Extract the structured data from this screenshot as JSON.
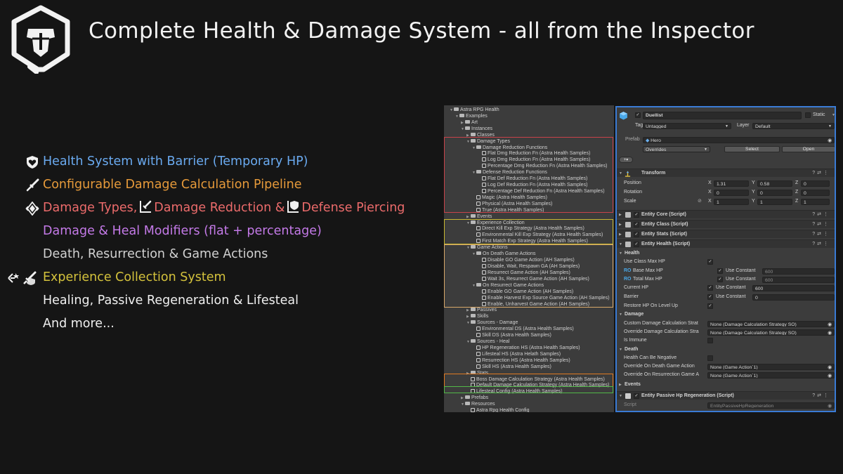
{
  "title": "Complete Health & Damage System - all from the Inspector",
  "colors": {
    "blue": "#6aaaf0",
    "orange": "#e69a3a",
    "red": "#ec6b6b",
    "purple": "#c47ae8",
    "gray": "#d2d2d2",
    "yellow": "#d4c23c",
    "white": "#f0f0f0"
  },
  "features": [
    {
      "text": "Health System with Barrier (Temporary HP)",
      "color": "#6aaaf0",
      "icon": "heart-shield-icon"
    },
    {
      "text": "Configurable Damage Calculation Pipeline",
      "color": "#e69a3a",
      "icon": "sword-icon"
    },
    {
      "part1": "Damage Types,",
      "part2": "Damage Reduction &",
      "part3": "Defense Piercing",
      "color": "#ec6b6b",
      "icon": "damage-types-icon"
    },
    {
      "text": "Damage & Heal Modifiers (flat + percentage)",
      "color": "#c47ae8"
    },
    {
      "text": "Death, Resurrection & Game Actions",
      "color": "#d2d2d2"
    },
    {
      "text": "Experience Collection System",
      "color": "#d4c23c",
      "icon": "experience-icon"
    },
    {
      "text": "Healing, Passive Regeneration & Lifesteal",
      "color": "#f0f0f0"
    },
    {
      "text": "And more...",
      "color": "#f0f0f0"
    }
  ],
  "hierarchy": [
    {
      "t": "Astra RPG Health",
      "d": 0,
      "f": 1,
      "e": 1
    },
    {
      "t": "Examples",
      "d": 1,
      "f": 1,
      "e": 1
    },
    {
      "t": "Art",
      "d": 2,
      "f": 1,
      "e": 0
    },
    {
      "t": "Instances",
      "d": 2,
      "f": 1,
      "e": 1
    },
    {
      "t": "Classes",
      "d": 3,
      "f": 1,
      "e": 0
    },
    {
      "t": "Damage Types",
      "d": 3,
      "f": 1,
      "e": 1
    },
    {
      "t": "Damage Reduction Functions",
      "d": 4,
      "f": 1,
      "e": 1
    },
    {
      "t": "Flat Dmg Reduction Fn (Astra Health Samples)",
      "d": 5,
      "f": 0
    },
    {
      "t": "Log Dmg Reduction Fn (Astra Health Samples)",
      "d": 5,
      "f": 0
    },
    {
      "t": "Percentage Dmg Reduction  Fn (Astra Health Samples)",
      "d": 5,
      "f": 0
    },
    {
      "t": "Defense Reduction Functions",
      "d": 4,
      "f": 1,
      "e": 1
    },
    {
      "t": "Flat Def Reduction Fn (Astra Health Samples)",
      "d": 5,
      "f": 0
    },
    {
      "t": "Log Def Reduction Fn (Astra Health Samples)",
      "d": 5,
      "f": 0
    },
    {
      "t": "Percentage Def Reduction Fn (Astra Health Samples)",
      "d": 5,
      "f": 0
    },
    {
      "t": "Magic (Astra Health Samples)",
      "d": 4,
      "f": 0
    },
    {
      "t": "Physical (Astra Health Samples)",
      "d": 4,
      "f": 0
    },
    {
      "t": "True (Astra Health Samples)",
      "d": 4,
      "f": 0
    },
    {
      "t": "Events",
      "d": 3,
      "f": 1,
      "e": 0
    },
    {
      "t": "Experience Collection",
      "d": 3,
      "f": 1,
      "e": 1
    },
    {
      "t": "Direct Kill Exp Strategy (Astra Health Samples)",
      "d": 4,
      "f": 0
    },
    {
      "t": "Environmental Kill Exp Strategy (Astra Health Samples)",
      "d": 4,
      "f": 0
    },
    {
      "t": "First Match Exp Strategy (Astra Health Samples)",
      "d": 4,
      "f": 0
    },
    {
      "t": "Game Actions",
      "d": 3,
      "f": 1,
      "e": 1
    },
    {
      "t": "On Death Game Actions",
      "d": 4,
      "f": 1,
      "e": 1
    },
    {
      "t": "Disable GO Game Action (AH Samples)",
      "d": 5,
      "f": 0
    },
    {
      "t": "Disable, Wait, Respawn GA (AH Samples)",
      "d": 5,
      "f": 0
    },
    {
      "t": "Resurrect Game Action (AH Samples)",
      "d": 5,
      "f": 0
    },
    {
      "t": "Wait 3s, Resurrect Game Action (AH Samples)",
      "d": 5,
      "f": 0
    },
    {
      "t": "On Resurrect Game Actions",
      "d": 4,
      "f": 1,
      "e": 1
    },
    {
      "t": "Enable GO Game Action (AH Samples)",
      "d": 5,
      "f": 0
    },
    {
      "t": "Enable Harvest Exp Source Game Action (AH Samples)",
      "d": 5,
      "f": 0
    },
    {
      "t": "Enable, Unharvest Game Action (AH Samples)",
      "d": 5,
      "f": 0
    },
    {
      "t": "Passives",
      "d": 3,
      "f": 1,
      "e": 0
    },
    {
      "t": "Skills",
      "d": 3,
      "f": 1,
      "e": 0
    },
    {
      "t": "Sources - Damage",
      "d": 3,
      "f": 1,
      "e": 1
    },
    {
      "t": "Environmental DS (Astra Health Samples)",
      "d": 4,
      "f": 0
    },
    {
      "t": "Skill DS (Astra Health Samples)",
      "d": 4,
      "f": 0
    },
    {
      "t": "Sources - Heal",
      "d": 3,
      "f": 1,
      "e": 1
    },
    {
      "t": "HP Regeneration HS (Astra Health Samples)",
      "d": 4,
      "f": 0
    },
    {
      "t": "Lifesteal HS (Astra Helath Samples)",
      "d": 4,
      "f": 0
    },
    {
      "t": "Resurrection HS (Astra Health Samples)",
      "d": 4,
      "f": 0
    },
    {
      "t": "Skill HS (Astra Health Samples)",
      "d": 4,
      "f": 0
    },
    {
      "t": "Stats",
      "d": 3,
      "f": 1,
      "e": 0
    },
    {
      "t": "Boss Damage Calculation Strategy (Astra Health Samples)",
      "d": 3,
      "f": 0
    },
    {
      "t": "Default Damage Calculation Strategy (Astra Health Samples)",
      "d": 3,
      "f": 0
    },
    {
      "t": "Lifesteal Config (Astra Health Samples)",
      "d": 3,
      "f": 0
    },
    {
      "t": "Prefabs",
      "d": 2,
      "f": 1,
      "e": 0
    },
    {
      "t": "Resources",
      "d": 2,
      "f": 1,
      "e": 1
    },
    {
      "t": "Astra Rpg Health Config",
      "d": 3,
      "f": 0
    }
  ],
  "inspector": {
    "name": "Duellist",
    "static_label": "Static",
    "tag_label": "Tag",
    "tag_value": "Untagged",
    "layer_label": "Layer",
    "layer_value": "Default",
    "prefab_label": "Prefab",
    "prefab_value": "Hero",
    "overrides": "Overrides",
    "select": "Select",
    "open": "Open",
    "transform": "Transform",
    "position": "Position",
    "rotation": "Rotation",
    "scale": "Scale",
    "pos": [
      "1.31",
      "0.58",
      "0"
    ],
    "rot": [
      "0",
      "0",
      "0"
    ],
    "scl": [
      "1",
      "1",
      "1"
    ],
    "x": "X",
    "y": "Y",
    "z": "Z",
    "entity_core": "Entity Core (Script)",
    "entity_class": "Entity Class (Script)",
    "entity_stats": "Entity Stats (Script)",
    "entity_health": "Entity Health (Script)",
    "health": "Health",
    "use_class_max_hp": "Use Class Max HP",
    "ro": "RO",
    "base_max_hp": "Base Max HP",
    "total_max_hp": "Total Max HP",
    "current_hp": "Current HP",
    "barrier": "Barrier",
    "restore_hp": "Restore HP On Level Up",
    "use_constant": "Use Constant",
    "base_val": "600",
    "total_val": "600",
    "current_val": "600",
    "barrier_val": "0",
    "damage": "Damage",
    "custom_dmg": "Custom Damage Calculation Strat",
    "override_dmg": "Override Damage Calculation Stra",
    "dmg_none": "None (Damage Calculation Strategy SO)",
    "is_immune": "Is Immune",
    "death": "Death",
    "health_neg": "Health Can Be Negative",
    "override_death": "Override On Death Game Action",
    "override_res": "Override On Resurrection Game A",
    "ga_none": "None (Game Action`1)",
    "events": "Events",
    "passive_regen": "Entity Passive Hp Regeneration (Script)",
    "script_label": "Script",
    "script_value": "EntityPassiveHpRegeneration"
  }
}
